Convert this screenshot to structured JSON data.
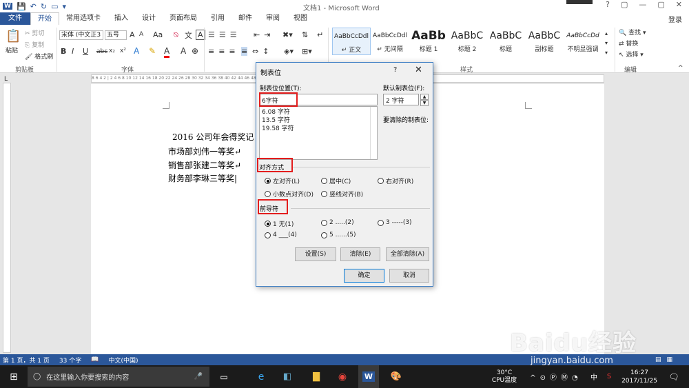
{
  "window": {
    "title": "文档1 - Microsoft Word",
    "controls": [
      "?",
      "▢",
      "—",
      "▢",
      "✕"
    ],
    "login": "登录"
  },
  "qat": {
    "logo": "W"
  },
  "tabs": [
    "文件",
    "开始",
    "常用选项卡",
    "插入",
    "设计",
    "页面布局",
    "引用",
    "邮件",
    "审阅",
    "视图"
  ],
  "ribbon": {
    "clipboard": {
      "paste": "粘贴",
      "cut": "剪切",
      "copy": "复制",
      "format_painter": "格式刷",
      "label": "剪贴板"
    },
    "font": {
      "name": "宋体 (中文正3",
      "size": "五号",
      "grow": "A",
      "shrink": "A",
      "aa": "Aa",
      "bold": "B",
      "italic": "I",
      "underline": "U",
      "strike": "abc",
      "sub": "x₂",
      "sup": "x²",
      "label": "字体"
    },
    "paragraph": {
      "label": "段落"
    },
    "styles": {
      "label": "样式",
      "items": [
        {
          "preview": "AaBbCcDdl",
          "name": "↵ 正文"
        },
        {
          "preview": "AaBbCcDdl",
          "name": "↵ 无间隔"
        },
        {
          "preview": "AaBb",
          "name": "标题 1"
        },
        {
          "preview": "AaBbC",
          "name": "标题 2"
        },
        {
          "preview": "AaBbC",
          "name": "标题"
        },
        {
          "preview": "AaBbC",
          "name": "副标题"
        },
        {
          "preview": "AaBbCcDd",
          "name": "不明显强调"
        }
      ]
    },
    "editing": {
      "find": "查找 ▾",
      "replace": "替换",
      "select": "选择 ▾",
      "label": "编辑"
    }
  },
  "ruler": "8 6 4 2 | 2 4 6 8 10 12 14 16 18 20 22 24 26 28 30 32 34 36 38 40 42 44 46 48",
  "document": {
    "lines": [
      "2016 公司年会得奖记",
      "市场部刘伟一等奖↵",
      "销售部张建二等奖↵",
      "财务部李琳三等奖|"
    ]
  },
  "dialog": {
    "title": "制表位",
    "help": "?",
    "close": "✕",
    "tab_pos_label": "制表位位置(T):",
    "tab_pos_value": "6字符",
    "default_label": "默认制表位(F):",
    "default_value": "2 字符",
    "clear_label": "要清除的制表位:",
    "list": [
      "6.08 字符",
      "13.5 字符",
      "19.58 字符"
    ],
    "align_label": "对齐方式",
    "align": [
      "左对齐(L)",
      "居中(C)",
      "右对齐(R)",
      "小数点对齐(D)",
      "竖线对齐(B)"
    ],
    "leader_label": "前导符",
    "leader": [
      "1 无(1)",
      "2 .....(2)",
      "3 -----(3)",
      "4 ___(4)",
      "5 ......(5)"
    ],
    "btn_set": "设置(S)",
    "btn_clear": "清除(E)",
    "btn_clear_all": "全部清除(A)",
    "btn_ok": "确定",
    "btn_cancel": "取消"
  },
  "status": {
    "page": "第 1 页，共 1 页",
    "words": "33 个字",
    "lang": "中文(中国)"
  },
  "taskbar": {
    "search": "在这里输入你要搜索的内容",
    "temp": "30°C",
    "cpu": "CPU温度",
    "ime": "中",
    "time": "16:27",
    "date": "2017/11/25"
  },
  "watermark": {
    "text": "Baidu经验",
    "url": "jingyan.baidu.com"
  },
  "colors": {
    "word_blue": "#2b579a",
    "highlight_red": "#e31d1d",
    "dialog_border": "#3f7fc5"
  }
}
